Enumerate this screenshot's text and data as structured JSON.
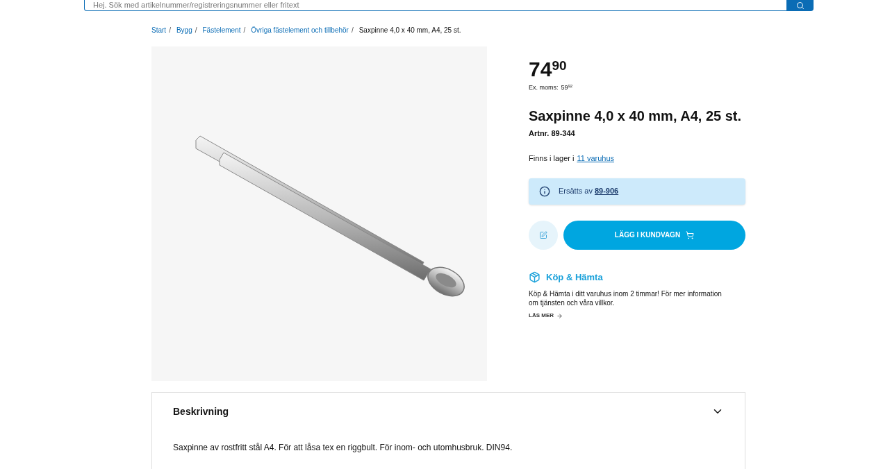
{
  "search": {
    "placeholder": "Hej. Sök med artikelnummer/registreringsnummer eller fritext"
  },
  "breadcrumb_separator": "/",
  "breadcrumb": [
    {
      "label": "Start",
      "current": false
    },
    {
      "label": "Bygg",
      "current": false
    },
    {
      "label": "Fästelement",
      "current": false
    },
    {
      "label": "Övriga fästelement och tillbehör",
      "current": false
    },
    {
      "label": "Saxpinne 4,0 x 40 mm, A4, 25 st.",
      "current": true
    }
  ],
  "price": {
    "whole": "74",
    "decimals": "90",
    "ex_vat_label": "Ex. moms:",
    "ex_vat_whole": "59",
    "ex_vat_decimals": "92"
  },
  "product": {
    "title": "Saxpinne 4,0 x 40 mm, A4, 25 st.",
    "article_number": "Artnr. 89-344"
  },
  "stock": {
    "text": "Finns i lager i",
    "link": "11 varuhus"
  },
  "notice": {
    "text": "Ersätts av",
    "link": "89-906"
  },
  "add_to_cart": "LÄGG I KUNDVAGN",
  "click_collect": {
    "title": "Köp & Hämta",
    "text": "Köp & Hämta i ditt varuhus inom 2 timmar! För mer information om tjänsten och våra villkor.",
    "link": "LÄS MER"
  },
  "description": {
    "title": "Beskrivning",
    "expanded": true,
    "text": "Saxpinne av rostfritt stål A4. För att låsa tex en riggbult. För inom- och utomhusbruk. DIN94."
  }
}
